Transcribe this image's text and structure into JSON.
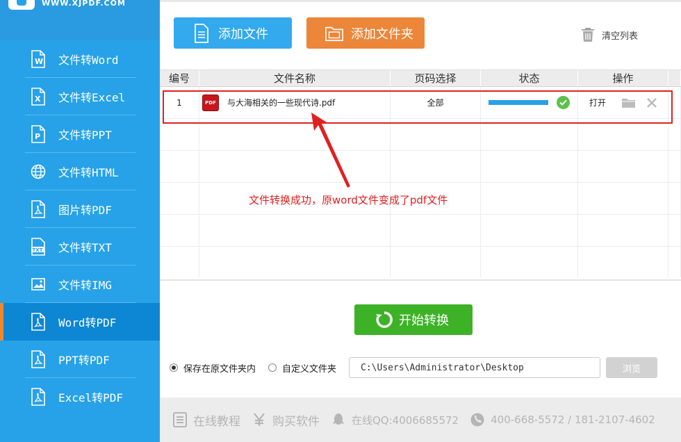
{
  "brand": {
    "url": "WWW.XJPDF.COM"
  },
  "sidebar": {
    "items": [
      {
        "label": "文件转Word",
        "icon": "word-doc-icon"
      },
      {
        "label": "文件转Excel",
        "icon": "excel-doc-icon"
      },
      {
        "label": "文件转PPT",
        "icon": "ppt-doc-icon"
      },
      {
        "label": "文件转HTML",
        "icon": "globe-icon"
      },
      {
        "label": "图片转PDF",
        "icon": "pdf-doc-icon"
      },
      {
        "label": "文件转TXT",
        "icon": "txt-doc-icon"
      },
      {
        "label": "文件转IMG",
        "icon": "image-icon"
      },
      {
        "label": "Word转PDF",
        "icon": "pdf-doc-icon",
        "active": true
      },
      {
        "label": "PPT转PDF",
        "icon": "pdf-doc-icon"
      },
      {
        "label": "Excel转PDF",
        "icon": "pdf-doc-icon"
      }
    ]
  },
  "toolbar": {
    "add_file_label": "添加文件",
    "add_folder_label": "添加文件夹",
    "clear_label": "清空列表"
  },
  "table": {
    "headers": [
      "编号",
      "文件名称",
      "页码选择",
      "状态",
      "操作"
    ],
    "rows": [
      {
        "index": "1",
        "file_badge": "PDF",
        "file_name": "与大海相关的一些现代诗.pdf",
        "pages": "全部",
        "progress": 1.0,
        "open_label": "打开"
      }
    ]
  },
  "annotation": {
    "text": "文件转换成功，原word文件变成了pdf文件"
  },
  "start_label": "开始转换",
  "output": {
    "option_original": "保存在原文件夹内",
    "option_custom": "自定义文件夹",
    "path": "C:\\Users\\Administrator\\Desktop",
    "browse_label": "浏览"
  },
  "footer": {
    "tutorial": "在线教程",
    "buy": "购买软件",
    "qq": "在线QQ:4006685572",
    "phone": "400-668-5572 / 181-2107-4602"
  },
  "colors": {
    "sidebar": "#27a2e8",
    "active": "#0d86d4",
    "accent_orange": "#ec8638",
    "blue_button": "#33a9ee",
    "start_green": "#3eb227",
    "annotation_red": "#e02020"
  }
}
